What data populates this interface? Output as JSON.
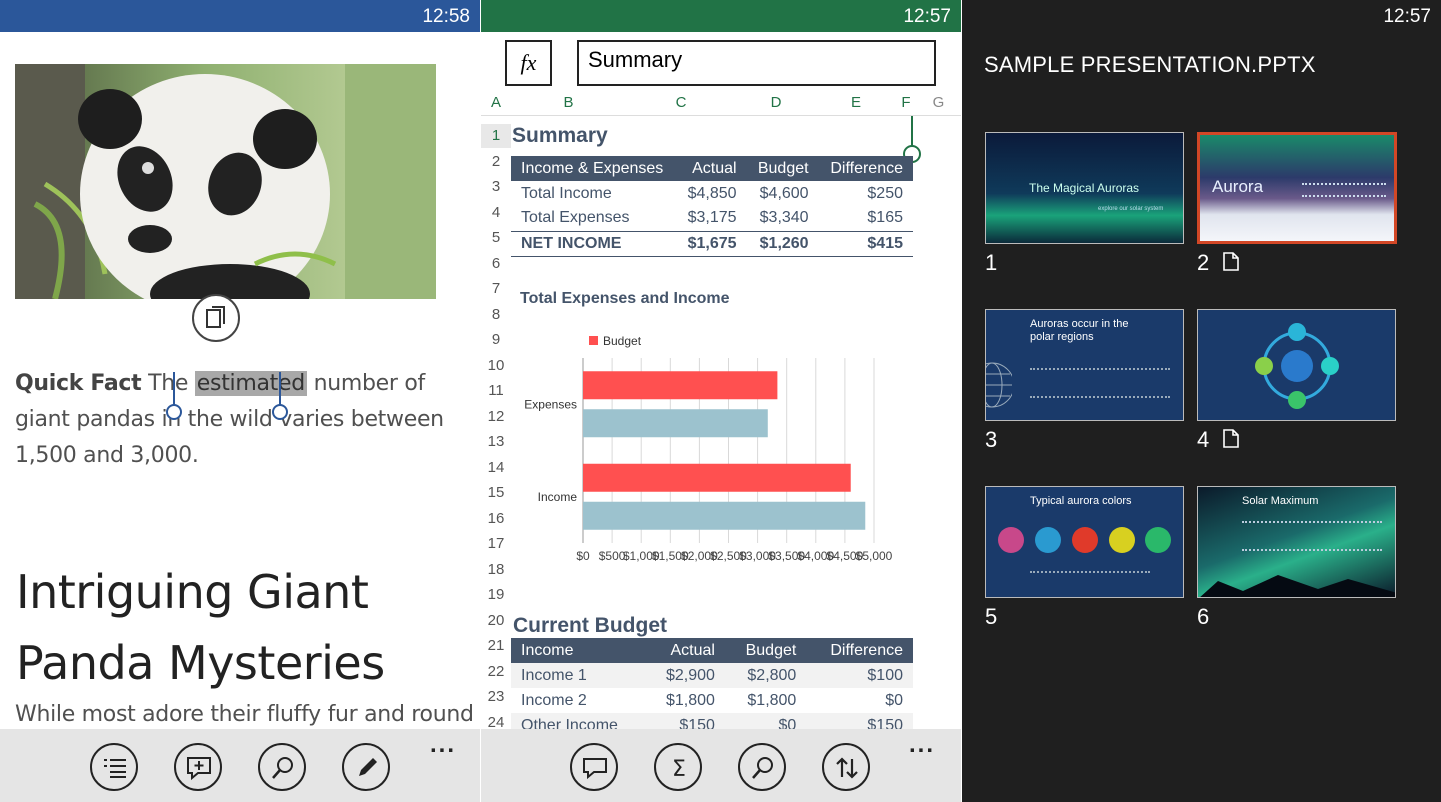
{
  "word": {
    "time": "12:58",
    "quick_fact_label": "Quick Fact",
    "para_before": " The ",
    "para_selected": "estimated",
    "para_after": " number of giant pandas in the wild varies between 1,500 and 3,000.",
    "heading": "Intriguing Giant Panda Mysteries",
    "body_text": "While most adore their fluffy fur and round",
    "more": "..."
  },
  "excel": {
    "time": "12:57",
    "fx_label": "fx",
    "formula_value": "Summary",
    "columns": [
      "A",
      "B",
      "C",
      "D",
      "E",
      "F",
      "G"
    ],
    "rows": [
      "1",
      "2",
      "3",
      "4",
      "5",
      "6",
      "7",
      "8",
      "9",
      "10",
      "11",
      "12",
      "13",
      "14",
      "15",
      "16",
      "17",
      "18",
      "19",
      "20",
      "21",
      "22",
      "23",
      "24"
    ],
    "summary_title": "Summary",
    "summary_headers": [
      "Income & Expenses",
      "Actual",
      "Budget",
      "Difference"
    ],
    "summary_rows": [
      [
        "Total Income",
        "$4,850",
        "$4,600",
        "$250"
      ],
      [
        "Total Expenses",
        "$3,175",
        "$3,340",
        "$165"
      ],
      [
        "NET INCOME",
        "$1,675",
        "$1,260",
        "$415"
      ]
    ],
    "chart_title": "Total Expenses and Income",
    "budget_title": "Current Budget",
    "budget_headers": [
      "Income",
      "Actual",
      "Budget",
      "Difference"
    ],
    "budget_rows": [
      [
        "Income 1",
        "$2,900",
        "$2,800",
        "$100"
      ],
      [
        "Income 2",
        "$1,800",
        "$1,800",
        "$0"
      ],
      [
        "Other Income",
        "$150",
        "$0",
        "$150"
      ]
    ],
    "more": "..."
  },
  "chart_data": {
    "type": "bar",
    "orientation": "horizontal",
    "title": "Total Expenses and Income",
    "categories": [
      "Expenses",
      "Income"
    ],
    "series": [
      {
        "name": "Budget",
        "values": [
          3340,
          4600
        ],
        "color": "#ff5050"
      },
      {
        "values": [
          3175,
          4850
        ],
        "color": "#9cc2ce"
      }
    ],
    "xlim": [
      0,
      5000
    ],
    "x_ticks": [
      "$0",
      "$500",
      "$1,000",
      "$1,500",
      "$2,000",
      "$2,500",
      "$3,000",
      "$3,500",
      "$4,000",
      "$4,500",
      "$5,000"
    ],
    "legend": "top-left",
    "grid": true
  },
  "ppt": {
    "time": "12:57",
    "title": "SAMPLE PRESENTATION.PPTX",
    "slides": [
      {
        "num": "1",
        "title": "The Magical Auroras",
        "subtitle": "explore our solar system",
        "has_notes": false
      },
      {
        "num": "2",
        "title": "Aurora",
        "has_notes": true
      },
      {
        "num": "3",
        "title": "Auroras occur in the polar regions",
        "has_notes": false
      },
      {
        "num": "4",
        "has_notes": true
      },
      {
        "num": "5",
        "title": "Typical aurora colors",
        "has_notes": false
      },
      {
        "num": "6",
        "title": "Solar Maximum",
        "has_notes": false
      }
    ]
  },
  "colors": {
    "word_blue": "#2b579a",
    "excel_green": "#217346",
    "ppt_dark": "#1f1f1f",
    "ppt_selected": "#d24726",
    "table_header": "#44546a"
  }
}
